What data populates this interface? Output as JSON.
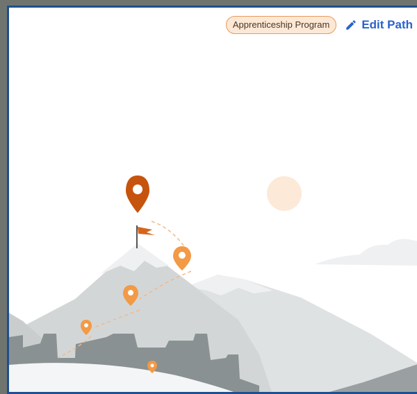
{
  "header": {
    "program_badge": "Apprenticeship Program",
    "edit_label": "Edit Path",
    "edit_icon": "pencil-icon"
  },
  "illustration": {
    "subject": "mountain career path with location pins",
    "pins": [
      "goal-pin",
      "milestone-pin",
      "milestone-pin",
      "milestone-pin",
      "milestone-pin"
    ],
    "icons": [
      "map-pin-icon",
      "flag-icon",
      "sun-icon",
      "cloud-icon"
    ]
  },
  "colors": {
    "frame_border": "#1f4f8f",
    "accent_link": "#2a63c9",
    "badge_bg": "#fde8d6",
    "badge_border": "#e59a5c",
    "goal_pin": "#c6540e",
    "milestone_pin": "#f29a45",
    "sun": "#fde9d8",
    "mountain_light": "#dde0e1",
    "mountain_dark": "#8a9193",
    "snow": "#eef0f1"
  }
}
